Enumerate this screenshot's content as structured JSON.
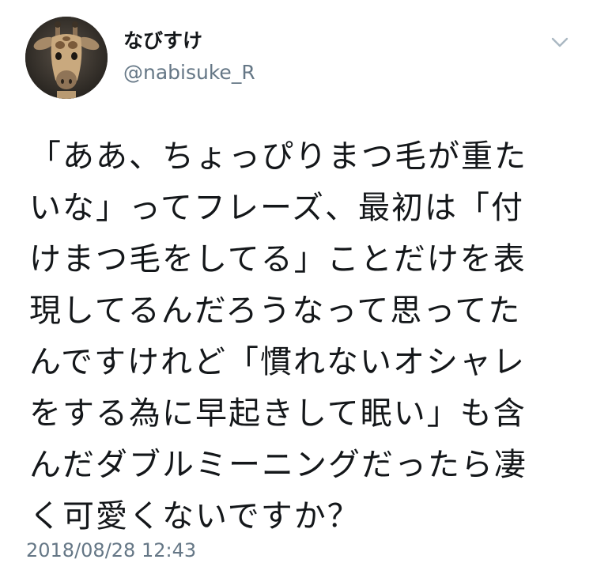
{
  "tweet": {
    "author": {
      "display_name": "なびすけ",
      "handle": "@nabisuke_R",
      "avatar_icon": "giraffe-avatar"
    },
    "menu_icon": "chevron-down-icon",
    "text_lines": [
      "「ああ、ちょっぴりまつ毛が重た",
      "いな」ってフレーズ、最初は「付",
      "けまつ毛をしてる」ことだけを表",
      "現してるんだろうなって思ってた",
      "んですけれど「慣れないオシャレ",
      "をする為に早起きして眠い」も含",
      "んだダブルミーニングだったら凄",
      "く可愛くないですか？"
    ],
    "timestamp": "2018/08/28 12:43"
  },
  "colors": {
    "text": "#14171a",
    "secondary": "#657786",
    "caret": "#aab8c2",
    "background": "#ffffff"
  }
}
